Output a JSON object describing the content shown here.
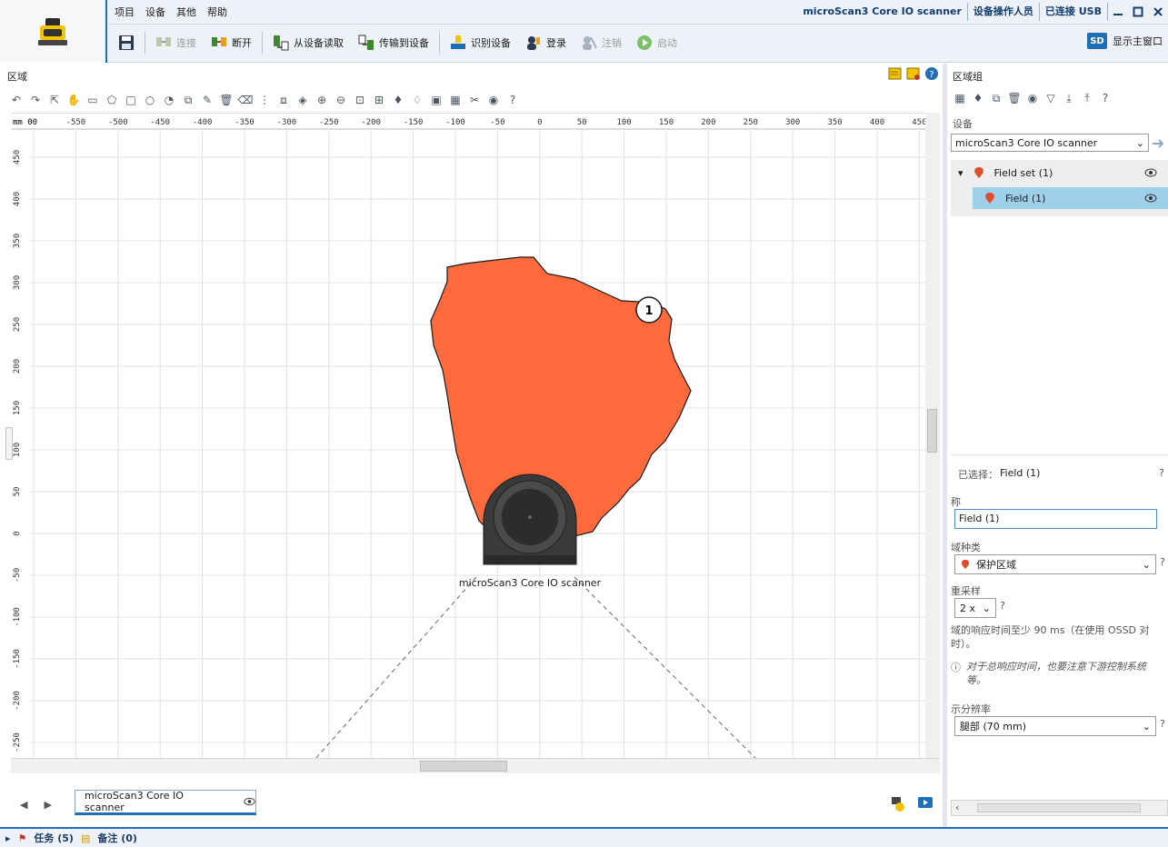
{
  "menu": [
    "项目",
    "设备",
    "其他",
    "帮助"
  ],
  "toolbar": {
    "connect": "连接",
    "disconnect": "断开",
    "read_from_device": "从设备读取",
    "transfer_to_device": "传输到设备",
    "identify_device": "识别设备",
    "login": "登录",
    "logout": "注销",
    "start": "启动"
  },
  "status": {
    "device_name": "microScan3 Core IO scanner",
    "user_role": "设备操作人员",
    "connection": "已连接 USB"
  },
  "main_window_button": "显示主窗口",
  "sd_badge": "SD",
  "area_panel": {
    "title": "区域",
    "ruler_unit": "mm",
    "x_ticks": [
      "-600",
      "-550",
      "-500",
      "-450",
      "-400",
      "-350",
      "-300",
      "-250",
      "-200",
      "-150",
      "-100",
      "-50",
      "0",
      "50",
      "100",
      "150",
      "200",
      "250",
      "300",
      "350",
      "400",
      "450"
    ],
    "y_ticks": [
      "450",
      "400",
      "350",
      "300",
      "250",
      "200",
      "150",
      "100",
      "50",
      "0",
      "-50",
      "-100",
      "-150",
      "-200",
      "-250"
    ],
    "scanner_label": "microScan3 Core IO scanner",
    "callout": "1",
    "field_color": "#ff6a3d"
  },
  "device_tab": "microScan3 Core IO scanner",
  "group_panel": {
    "title": "区域组",
    "device_label": "设备",
    "device_select": "microScan3 Core IO scanner",
    "tree": {
      "field_set": "Field set (1)",
      "field": "Field (1)"
    },
    "selected_label": "已选择：",
    "selected_value": "Field (1)",
    "name_label": "称",
    "name_value": "Field (1)",
    "type_label": "域种类",
    "type_value": "保护区域",
    "sampling_label": "重采样",
    "sampling_value": "2 x",
    "response_note": "域的响应时间至少 90 ms（在使用 OSSD 对时）。",
    "info_note": "对于总响应时间，也要注意下游控制系统等。",
    "resolution_label": "示分辨率",
    "resolution_value": "腿部 (70 mm)"
  },
  "bottom": {
    "tasks": "任务 (5)",
    "notes": "备注 (0)"
  }
}
